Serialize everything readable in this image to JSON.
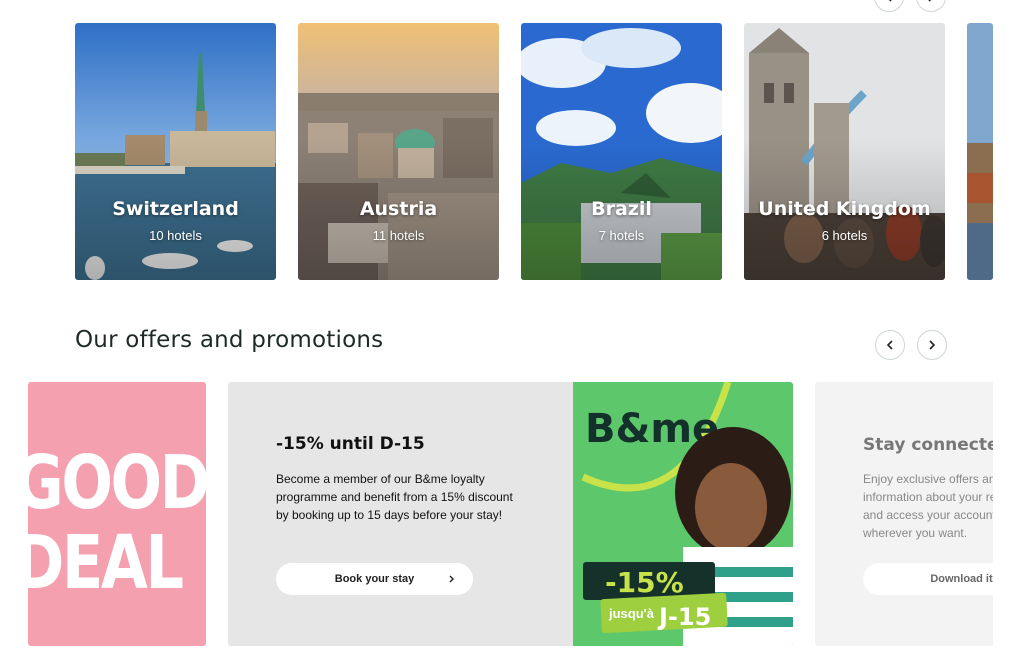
{
  "destinations": [
    {
      "name": "Switzerland",
      "count": "10 hotels"
    },
    {
      "name": "Austria",
      "count": "11 hotels"
    },
    {
      "name": "Brazil",
      "count": "7 hotels"
    },
    {
      "name": "United Kingdom",
      "count": "6 hotels"
    }
  ],
  "icons": {
    "prev": "chevron-left-icon",
    "next": "chevron-right-icon"
  },
  "offers": {
    "section_title": "Our offers and promotions",
    "good_deal": {
      "line1": "GOOD",
      "line2": "DEAL"
    },
    "main": {
      "title": "-15% until D-15",
      "text": "Become a member of our B&me loyalty programme and benefit from a 15% discount by booking up to 15 days before your stay!",
      "button": "Book your stay",
      "brand": "B&me",
      "badge_percent": "-15%",
      "badge_sub_a": "jusqu'à",
      "badge_sub_b": "J-15"
    },
    "side": {
      "title": "Stay connected",
      "text": "Enjoy exclusive offers and\ninformation about your res\nand access your account\nwherever you want.",
      "button": "Download it"
    }
  },
  "colors": {
    "accent_green": "#5dc86b",
    "pink": "#f4a0ae",
    "lime": "#c8e34a",
    "dark_text": "#1f2a28"
  }
}
